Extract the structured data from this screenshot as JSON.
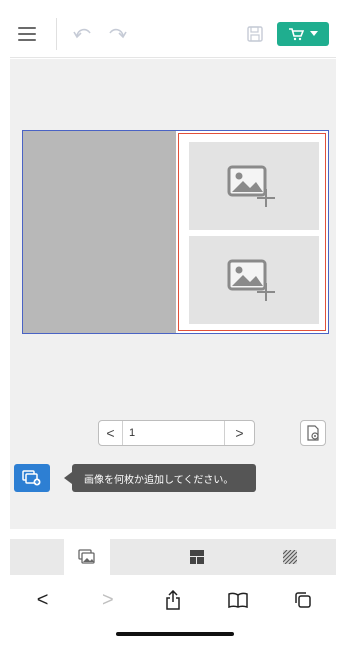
{
  "toolbar": {
    "icons": [
      "menu-icon",
      "undo-icon",
      "redo-icon",
      "save-icon",
      "cart-icon",
      "caret-down-icon"
    ],
    "accent": "#1fae8f"
  },
  "editor": {
    "spread_border_color": "#4a63c4",
    "selected_page_border_color": "#e2503a",
    "left_page_color": "#b8b8b8",
    "slots": [
      {
        "icon": "add-image-icon"
      },
      {
        "icon": "add-image-icon"
      }
    ]
  },
  "pager": {
    "prev_label": "<",
    "value": "1",
    "next_label": ">"
  },
  "add_photo": {
    "icon": "add-photo-icon",
    "tooltip": "画像を何枚か追加してください。",
    "accent": "#2d7fd3"
  },
  "tabs": [
    {
      "icon": "photos-icon",
      "active": true
    },
    {
      "icon": "layout-icon",
      "active": false
    },
    {
      "icon": "background-icon",
      "active": false
    }
  ],
  "browser": {
    "back_label": "<",
    "forward_label": ">",
    "icons": [
      "share-icon",
      "bookmarks-icon",
      "tabs-icon"
    ]
  }
}
